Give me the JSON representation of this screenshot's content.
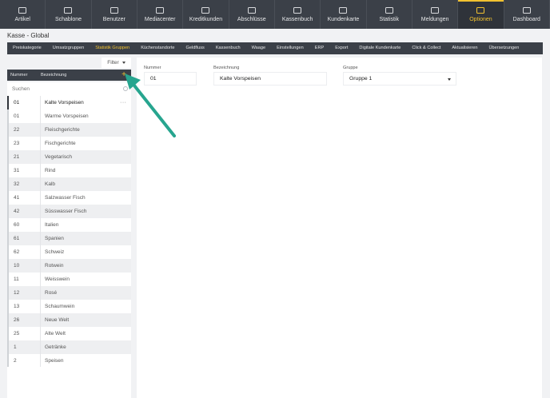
{
  "topnav": [
    {
      "label": "Artikel",
      "icon": "cart-icon"
    },
    {
      "label": "Schablone",
      "icon": "template-icon"
    },
    {
      "label": "Benutzer",
      "icon": "users-icon"
    },
    {
      "label": "Mediacenter",
      "icon": "monitor-icon"
    },
    {
      "label": "Kreditkunden",
      "icon": "credit-card-icon"
    },
    {
      "label": "Abschlüsse",
      "icon": "closing-icon"
    },
    {
      "label": "Kassenbuch",
      "icon": "book-icon"
    },
    {
      "label": "Kundenkarte",
      "icon": "card-icon"
    },
    {
      "label": "Statistik",
      "icon": "chart-icon"
    },
    {
      "label": "Meldungen",
      "icon": "mail-icon"
    },
    {
      "label": "Optionen",
      "icon": "gear-icon",
      "active": true
    },
    {
      "label": "Dashboard",
      "icon": "dashboard-icon"
    }
  ],
  "page_title": "Kasse - Global",
  "subnav": [
    {
      "label": "Preiskategorie"
    },
    {
      "label": "Umsatzgruppen"
    },
    {
      "label": "Statistik Gruppen",
      "active": true
    },
    {
      "label": "Küchenstandorte"
    },
    {
      "label": "Geldfluss"
    },
    {
      "label": "Kassenbuch"
    },
    {
      "label": "Waage"
    },
    {
      "label": "Einstellungen"
    },
    {
      "label": "ERP"
    },
    {
      "label": "Export"
    },
    {
      "label": "Digitale Kundenkarte"
    },
    {
      "label": "Click & Collect"
    },
    {
      "label": "Aktualisieren"
    },
    {
      "label": "Übersetzungen"
    }
  ],
  "filter": {
    "label": "Filter"
  },
  "list": {
    "col_number": "Nummer",
    "col_name": "Bezeichnung",
    "add_symbol": "+",
    "search_placeholder": "Suchen",
    "more_symbol": "···",
    "rows": [
      {
        "num": "01",
        "name": "Kalte Vorspeisen",
        "selected": true
      },
      {
        "num": "01",
        "name": "Warme Vorspeisen"
      },
      {
        "num": "22",
        "name": "Fleischgerichte"
      },
      {
        "num": "23",
        "name": "Fischgerichte"
      },
      {
        "num": "21",
        "name": "Vegetarisch"
      },
      {
        "num": "31",
        "name": "Rind"
      },
      {
        "num": "32",
        "name": "Kalb"
      },
      {
        "num": "41",
        "name": "Salzwasser Fisch"
      },
      {
        "num": "42",
        "name": "Süsswasser Fisch"
      },
      {
        "num": "60",
        "name": "Italien"
      },
      {
        "num": "61",
        "name": "Spanien"
      },
      {
        "num": "62",
        "name": "Schweiz"
      },
      {
        "num": "10",
        "name": "Rotwein"
      },
      {
        "num": "11",
        "name": "Weisswein"
      },
      {
        "num": "12",
        "name": "Rosé"
      },
      {
        "num": "13",
        "name": "Schaumwein"
      },
      {
        "num": "26",
        "name": "Neue Welt"
      },
      {
        "num": "25",
        "name": "Alte Welt"
      },
      {
        "num": "1",
        "name": "Getränke"
      },
      {
        "num": "2",
        "name": "Speisen"
      }
    ]
  },
  "detail": {
    "number_label": "Nummer",
    "number_value": "01",
    "name_label": "Bezeichnung",
    "name_value": "Kalte Vorspeisen",
    "group_label": "Gruppe",
    "group_value": "Gruppe 1"
  },
  "colors": {
    "accent": "#f2c230",
    "nav_bg": "#3b4048",
    "arrow": "#27a58f"
  }
}
